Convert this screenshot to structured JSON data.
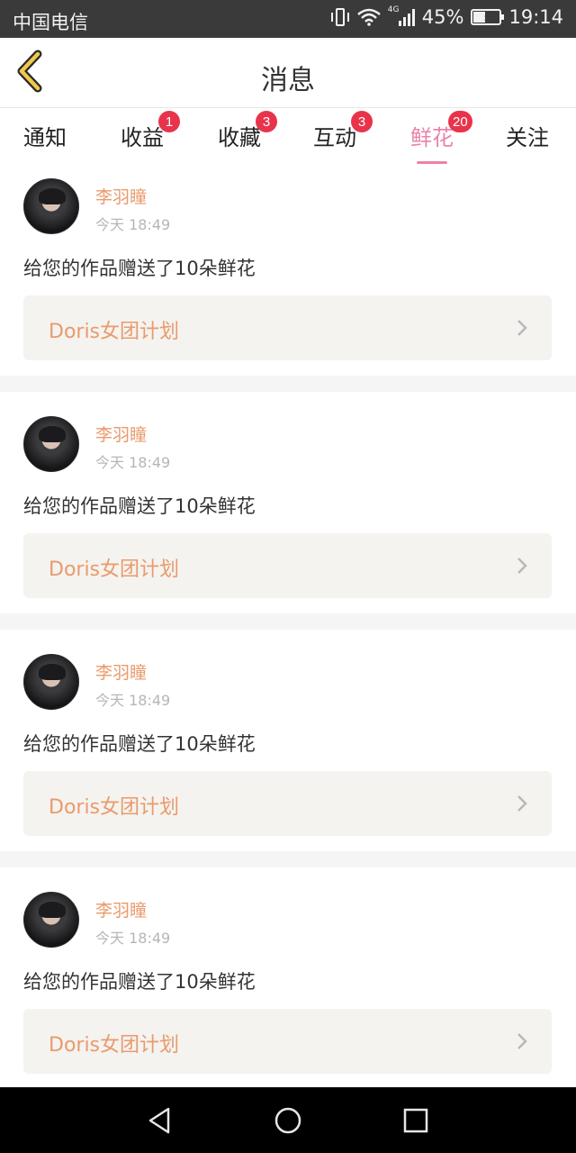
{
  "status_bar": {
    "carrier": "中国电信",
    "network": "4G",
    "battery": "45%",
    "battery_level": 0.45,
    "time": "19:14"
  },
  "header": {
    "title": "消息",
    "back_icon": "chevron-left-icon"
  },
  "colors": {
    "accent_pink": "#e883a9",
    "badge_red": "#e8344a",
    "name_orange": "#e99b6d"
  },
  "tabs": [
    {
      "label": "通知",
      "badge": ""
    },
    {
      "label": "收益",
      "badge": "1"
    },
    {
      "label": "收藏",
      "badge": "3"
    },
    {
      "label": "互动",
      "badge": "3"
    },
    {
      "label": "鲜花",
      "badge": "20",
      "active": true
    },
    {
      "label": "关注",
      "badge": ""
    }
  ],
  "messages": [
    {
      "name": "李羽瞳",
      "time": "今天 18:49",
      "text": "给您的作品赠送了10朵鲜花",
      "work": "Doris女团计划"
    },
    {
      "name": "李羽瞳",
      "time": "今天 18:49",
      "text": "给您的作品赠送了10朵鲜花",
      "work": "Doris女团计划"
    },
    {
      "name": "李羽瞳",
      "time": "今天 18:49",
      "text": "给您的作品赠送了10朵鲜花",
      "work": "Doris女团计划"
    },
    {
      "name": "李羽瞳",
      "time": "今天 18:49",
      "text": "给您的作品赠送了10朵鲜花",
      "work": "Doris女团计划"
    }
  ],
  "navbar": {
    "back_icon": "triangle-back-icon",
    "home_icon": "circle-home-icon",
    "recents_icon": "square-recents-icon"
  }
}
